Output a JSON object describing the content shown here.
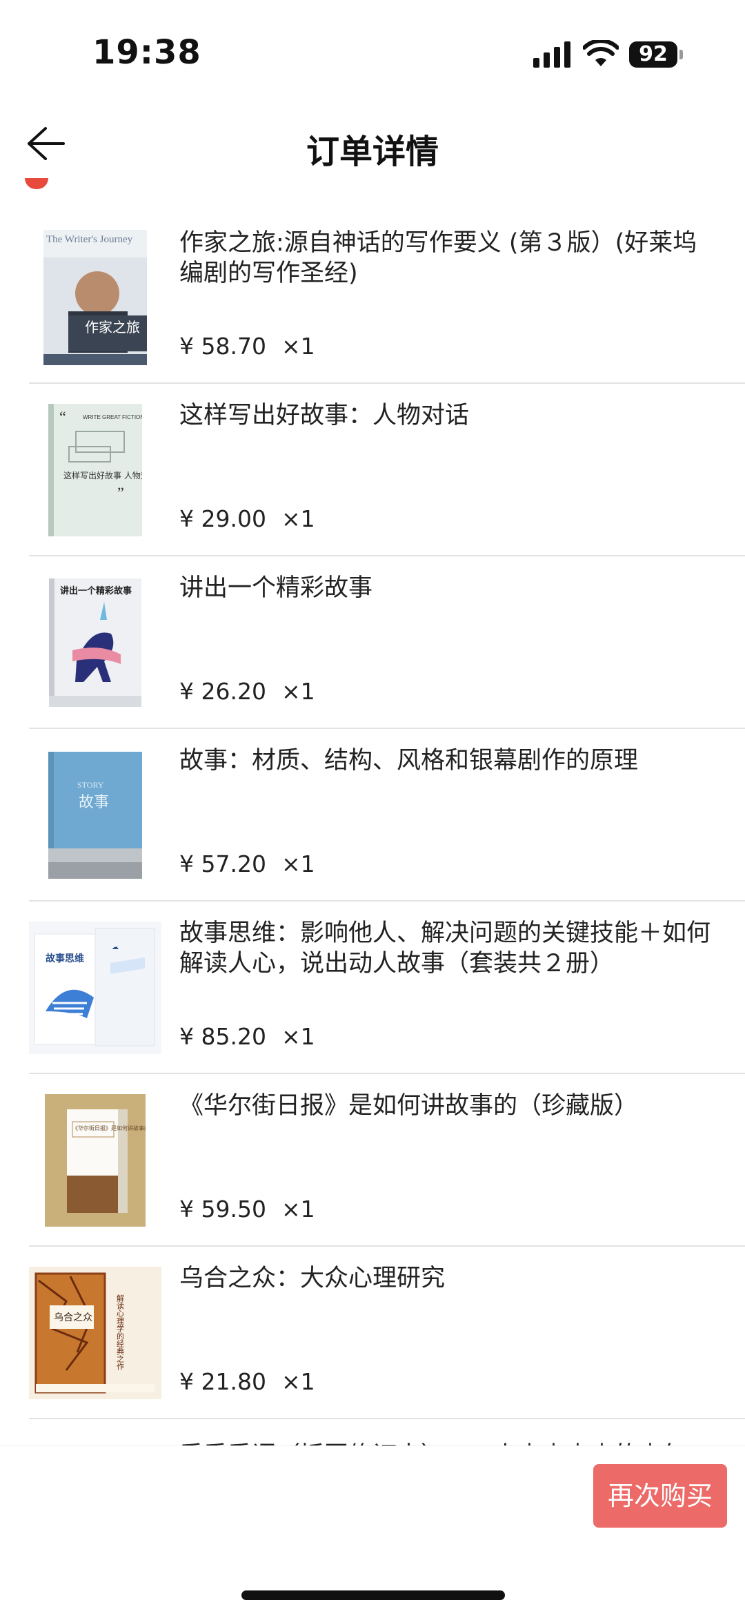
{
  "status_bar": {
    "time": "19:38",
    "battery": "92"
  },
  "nav": {
    "title": "订单详情"
  },
  "items": [
    {
      "title": "作家之旅:源自神话的写作要义 (第３版）(好莱坞编剧的写作圣经)",
      "price": "¥ 58.70",
      "qty": "×1",
      "cover_title": "The Writer's Journey",
      "cover_cn": "作家之旅"
    },
    {
      "title": "这样写出好故事：人物对话",
      "price": "¥ 29.00",
      "qty": "×1",
      "cover_title": "WRITE GREAT FICTION DIALOGUE",
      "cover_cn": "这样写出好故事 人物对话"
    },
    {
      "title": "讲出一个精彩故事",
      "price": "¥ 26.20",
      "qty": "×1",
      "cover_cn": "讲出一个精彩故事"
    },
    {
      "title": "故事：材质、结构、风格和银幕剧作的原理",
      "price": "¥ 57.20",
      "qty": "×1",
      "cover_title": "STORY",
      "cover_cn": "故事"
    },
    {
      "title": "故事思维：影响他人、解决问题的关键技能＋如何解读人心，说出动人故事（套装共２册）",
      "price": "¥ 85.20",
      "qty": "×1",
      "cover_cn": "故事思维"
    },
    {
      "title": "《华尔街日报》是如何讲故事的（珍藏版）",
      "price": "¥ 59.50",
      "qty": "×1",
      "cover_cn": "《华尔街日报》是如何讲故事的"
    },
    {
      "title": "乌合之众：大众心理研究",
      "price": "¥ 21.80",
      "qty": "×1",
      "cover_cn": "乌合之众",
      "cover_side": "解读心理学的经典之作"
    }
  ],
  "peek_text": "乖乖乖语（插图修订本）……人忠忠忠忠的忠年",
  "footer": {
    "rebuy_label": "再次购买"
  },
  "colors": {
    "accent": "#ec6a67",
    "badge": "#e84a3c",
    "divider": "#e3e3e3"
  }
}
